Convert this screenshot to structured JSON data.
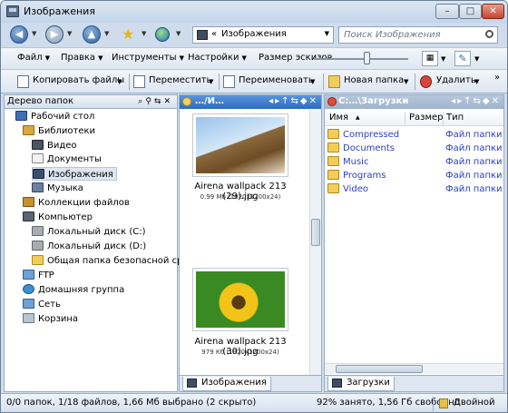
{
  "window": {
    "title": "Изображения",
    "controls": {
      "minimize": "–",
      "maximize": "□",
      "close": "✕"
    }
  },
  "address_bar": {
    "path_chevron": "«",
    "path": "Изображения",
    "search_placeholder": "Поиск Изображения"
  },
  "menu": {
    "items": [
      "Файл",
      "Правка",
      "Инструменты",
      "Настройки",
      "Размер эскизов"
    ]
  },
  "toolbar": {
    "copy": "Копировать файлы",
    "move": "Переместить",
    "rename": "Переименовать",
    "new_folder": "Новая папка",
    "delete": "Удалить"
  },
  "tree": {
    "header": "Дерево папок",
    "items": [
      {
        "label": "Рабочий стол",
        "icon": "desktop-icon"
      },
      {
        "label": "Библиотеки",
        "icon": "libraries-icon"
      },
      {
        "label": "Видео",
        "icon": "video-icon"
      },
      {
        "label": "Документы",
        "icon": "documents-icon"
      },
      {
        "label": "Изображения",
        "icon": "pictures-icon",
        "selected": true
      },
      {
        "label": "Музыка",
        "icon": "music-icon"
      },
      {
        "label": "Коллекции файлов",
        "icon": "collections-icon"
      },
      {
        "label": "Компьютер",
        "icon": "computer-icon"
      },
      {
        "label": "Локальный диск (C:)",
        "icon": "drive-icon"
      },
      {
        "label": "Локальный диск (D:)",
        "icon": "drive-icon"
      },
      {
        "label": "Общая папка безопасной среды",
        "icon": "shared-folder-icon"
      },
      {
        "label": "FTP",
        "icon": "ftp-icon"
      },
      {
        "label": "Домашняя группа",
        "icon": "homegroup-icon"
      },
      {
        "label": "Сеть",
        "icon": "network-icon"
      },
      {
        "label": "Корзина",
        "icon": "recycle-bin-icon"
      }
    ]
  },
  "middle_pane": {
    "header": "…/И…",
    "files": [
      {
        "name": "Airena wallpack 213 (29).jpg",
        "meta": "0.99 Мб (1920x1200x24)"
      },
      {
        "name": "Airena wallpack 213 (30).jpg",
        "meta": "979 Кб (1920x1200x24)"
      }
    ],
    "tab": "Изображения"
  },
  "right_pane": {
    "header": "C:…\\Загрузки",
    "columns": [
      "Имя",
      "Размер",
      "Тип"
    ],
    "rows": [
      {
        "name": "Compressed",
        "type": "Файл папки"
      },
      {
        "name": "Documents",
        "type": "Файл папки"
      },
      {
        "name": "Music",
        "type": "Файл папки"
      },
      {
        "name": "Programs",
        "type": "Файл папки"
      },
      {
        "name": "Video",
        "type": "Файл папки"
      }
    ],
    "tab": "Загрузки"
  },
  "status": {
    "left": "0/0 папок, 1/18 файлов, 1,66 Мб выбрано (2 скрыто)",
    "right": "92% занято, 1,56 Гб свободно",
    "mode": "Двойной"
  },
  "colors": {
    "accent": "#2c6bc0",
    "link": "#2a3fc0",
    "window_frame": "#cfdcec"
  }
}
